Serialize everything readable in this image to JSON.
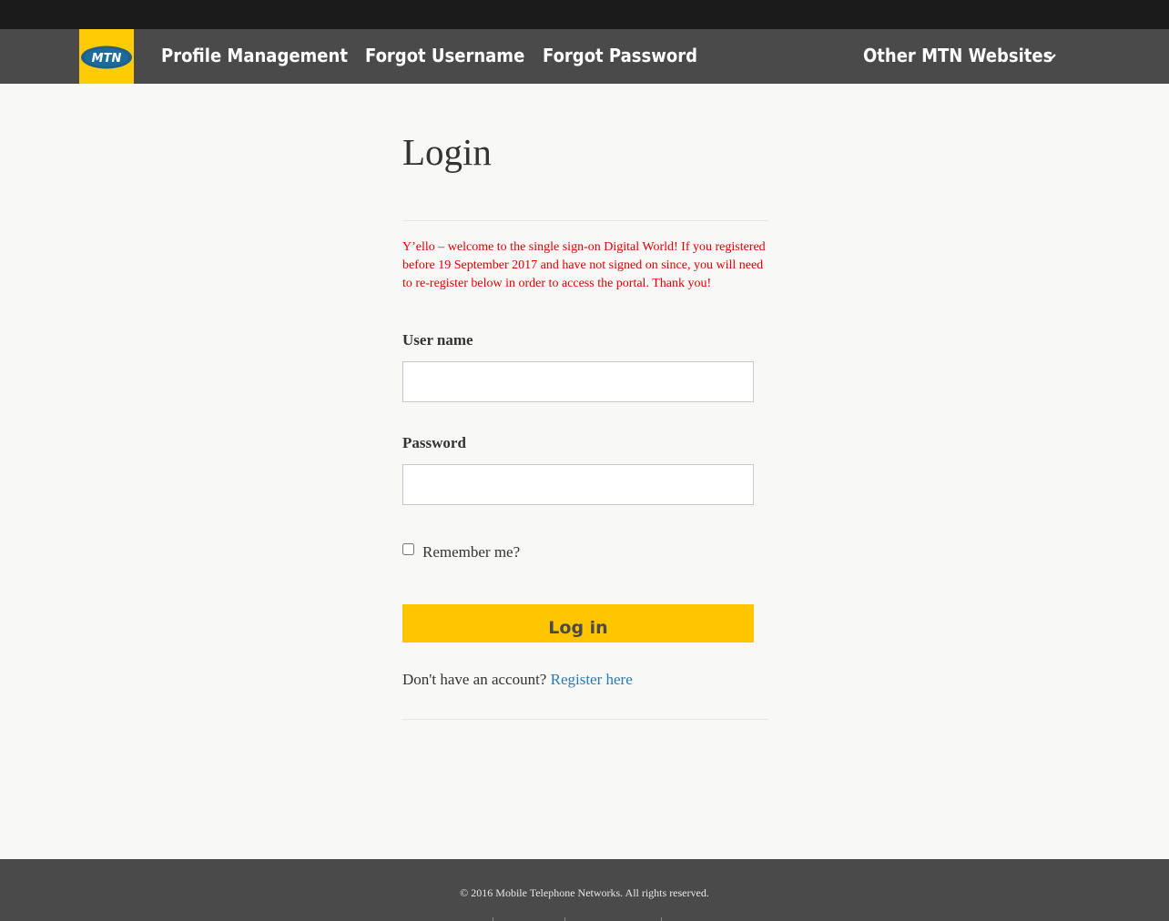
{
  "nav": {
    "logo_text": "MTN",
    "links": [
      {
        "label": "Profile Management"
      },
      {
        "label": "Forgot Username"
      },
      {
        "label": "Forgot Password"
      }
    ],
    "other_sites": {
      "label": "Other MTN Websites",
      "icon": "chevron-down-icon"
    }
  },
  "main": {
    "title": "Login",
    "notice": "Y’ello – welcome to the single sign-on Digital World! If you registered before 19 September 2017 and have not signed on since, you will need to re-register below in order to access the portal. Thank you!",
    "username": {
      "label": "User name",
      "value": "",
      "placeholder": ""
    },
    "password": {
      "label": "Password",
      "value": "",
      "placeholder": ""
    },
    "remember": {
      "label": "Remember me?",
      "checked": false
    },
    "login_button": "Log in",
    "register_prompt": "Don't have an account?",
    "register_link": "Register here"
  },
  "footer": {
    "copyright": "© 2016 Mobile Telephone Networks. All rights reserved."
  },
  "colors": {
    "brand_yellow": "#ffcb05",
    "button_yellow": "#ffc600",
    "nav_bg": "#4a4a4a",
    "top_bar": "#1b1b1b",
    "notice_red": "#dd0000",
    "link_blue": "#2a7ab0"
  }
}
